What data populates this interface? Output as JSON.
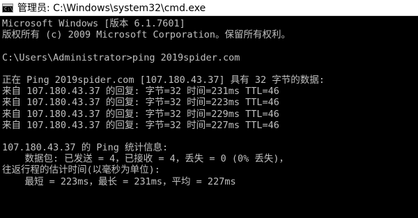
{
  "window": {
    "title": "管理员: C:\\Windows\\system32\\cmd.exe",
    "icon": "cmd-console-icon",
    "icon_glyph": "C:\\"
  },
  "console": {
    "colors": {
      "background": "#000000",
      "text": "#c0c0c0"
    },
    "lines": [
      "Microsoft Windows [版本 6.1.7601]",
      "版权所有 (c) 2009 Microsoft Corporation。保留所有权利。",
      "",
      "C:\\Users\\Administrator>ping 2019spider.com",
      "",
      "正在 Ping 2019spider.com [107.180.43.37] 具有 32 字节的数据:",
      "来自 107.180.43.37 的回复: 字节=32 时间=231ms TTL=46",
      "来自 107.180.43.37 的回复: 字节=32 时间=223ms TTL=46",
      "来自 107.180.43.37 的回复: 字节=32 时间=229ms TTL=46",
      "来自 107.180.43.37 的回复: 字节=32 时间=227ms TTL=46",
      "",
      "107.180.43.37 的 Ping 统计信息:",
      "    数据包: 已发送 = 4，已接收 = 4，丢失 = 0 (0% 丢失)，",
      "往返行程的估计时间(以毫秒为单位):",
      "    最短 = 223ms，最长 = 231ms，平均 = 227ms",
      ""
    ]
  }
}
